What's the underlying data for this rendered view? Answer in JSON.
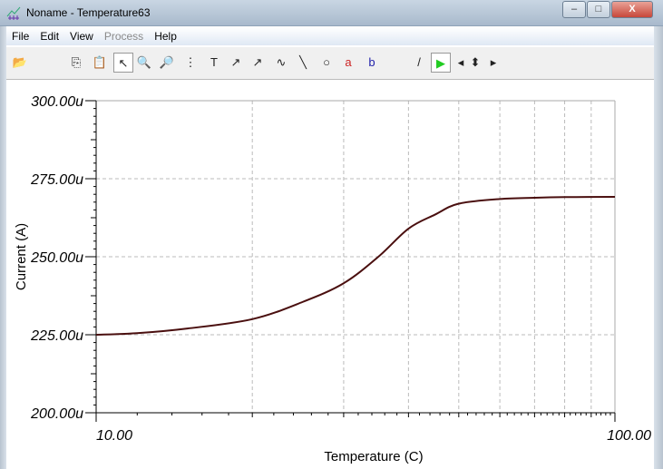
{
  "window": {
    "title": "Noname - Temperature63",
    "minimize": "–",
    "maximize": "□",
    "close": "X"
  },
  "menu": [
    {
      "label": "File",
      "enabled": true
    },
    {
      "label": "Edit",
      "enabled": true
    },
    {
      "label": "View",
      "enabled": true
    },
    {
      "label": "Process",
      "enabled": false
    },
    {
      "label": "Help",
      "enabled": true
    }
  ],
  "toolbar": [
    {
      "icon": "open-folder-icon",
      "glyph": "📂"
    },
    {
      "icon": "copy-icon",
      "glyph": "⎘"
    },
    {
      "icon": "paste-icon",
      "glyph": "📋"
    },
    {
      "icon": "pointer-icon",
      "glyph": "↖"
    },
    {
      "icon": "zoom-in-icon",
      "glyph": "🔍"
    },
    {
      "icon": "zoom-out-icon",
      "glyph": "🔎"
    },
    {
      "icon": "grid-icon",
      "glyph": "⋮"
    },
    {
      "icon": "text-icon",
      "glyph": "T"
    },
    {
      "icon": "curve-label-icon",
      "glyph": "↗"
    },
    {
      "icon": "curve-query-icon",
      "glyph": "↗"
    },
    {
      "icon": "curve-formula-icon",
      "glyph": "∿"
    },
    {
      "icon": "line-icon",
      "glyph": "╲"
    },
    {
      "icon": "circle-icon",
      "glyph": "○"
    },
    {
      "icon": "cursor-a-icon",
      "glyph": "a"
    },
    {
      "icon": "cursor-b-icon",
      "glyph": "b"
    },
    {
      "icon": "blank-icon",
      "glyph": ""
    },
    {
      "icon": "probe-icon",
      "glyph": "/"
    },
    {
      "icon": "play-icon",
      "glyph": "▶"
    },
    {
      "icon": "arrow-left-icon",
      "glyph": "◂"
    },
    {
      "icon": "arrow-updown-icon",
      "glyph": "⬍"
    },
    {
      "icon": "arrow-right-icon",
      "glyph": "▸"
    }
  ],
  "chart_data": {
    "type": "line",
    "title": "",
    "xlabel": "Temperature (C)",
    "ylabel": "Current (A)",
    "xscale": "log",
    "xlim": [
      10,
      100
    ],
    "ylim": [
      200,
      300
    ],
    "y_unit_suffix": "u",
    "x_tick_labels": [
      "10.00",
      "100.00"
    ],
    "y_tick_labels": [
      "200.00u",
      "225.00u",
      "250.00u",
      "275.00u",
      "300.00u"
    ],
    "y_ticks": [
      200,
      225,
      250,
      275,
      300
    ],
    "x_gridlines": [
      20,
      30,
      40,
      50,
      60,
      70,
      80,
      90
    ],
    "grid": true,
    "line_color": "#4a0f0f",
    "series": [
      {
        "name": "Current",
        "x": [
          10,
          12,
          15,
          20,
          25,
          30,
          35,
          40,
          45,
          50,
          60,
          70,
          80,
          100
        ],
        "y": [
          225,
          225.5,
          227,
          230,
          235.5,
          241.5,
          250,
          259,
          263.5,
          267,
          268.5,
          268.9,
          269.1,
          269.2
        ]
      }
    ]
  }
}
